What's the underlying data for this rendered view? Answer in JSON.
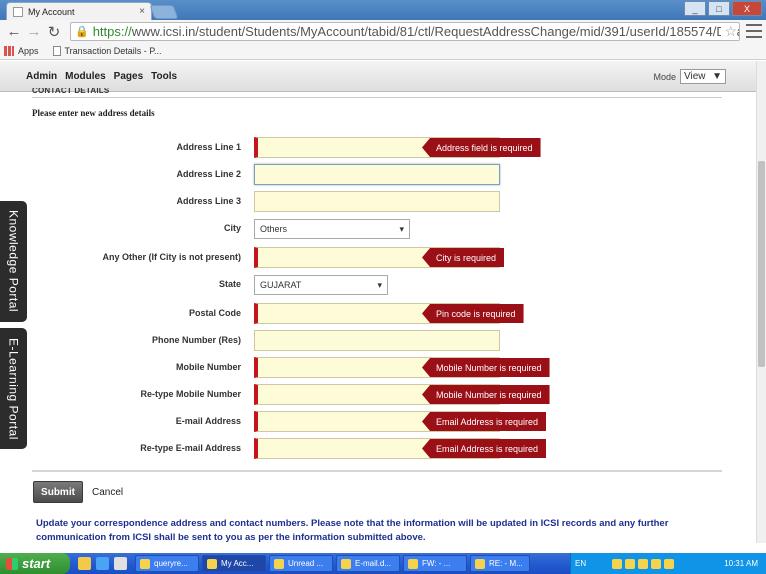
{
  "browser": {
    "tab_title": "My Account",
    "tab_close": "×",
    "url_https": "https://",
    "url_rest": "www.icsi.in/student/Students/MyAccount/tabid/81/ctl/RequestAddressChange/mid/391/userId/185574/Default.a",
    "bookmarks": [
      "Apps",
      "Transaction Details - P..."
    ],
    "window_buttons": [
      "_",
      "□",
      "X"
    ]
  },
  "admin_bar": {
    "links": [
      "Admin",
      "Modules",
      "Pages",
      "Tools"
    ],
    "mode_label": "Mode",
    "mode_value": "View"
  },
  "form": {
    "section_heading": "CONTACT DETAILS",
    "instruction": "Please enter new address details",
    "fields": {
      "address1": {
        "label": "Address Line 1",
        "error": "Address field is required"
      },
      "address2": {
        "label": "Address Line 2"
      },
      "address3": {
        "label": "Address Line 3"
      },
      "city": {
        "label": "City",
        "value": "Others"
      },
      "other_city": {
        "label": "Any Other (If City is not present)",
        "error": "City is required"
      },
      "state": {
        "label": "State",
        "value": "GUJARAT"
      },
      "postal": {
        "label": "Postal Code",
        "error": "Pin code is required"
      },
      "phone": {
        "label": "Phone Number (Res)"
      },
      "mobile": {
        "label": "Mobile Number",
        "error": "Mobile Number is required"
      },
      "mobile2": {
        "label": "Re-type Mobile Number",
        "error": "Mobile Number is required"
      },
      "email": {
        "label": "E-mail Address",
        "error": "Email Address is required"
      },
      "email2": {
        "label": "Re-type E-mail Address",
        "error": "Email Address is required"
      }
    },
    "submit_label": "Submit",
    "cancel_label": "Cancel",
    "notice": "Update your correspondence address and contact numbers. Please note that the information will be updated in ICSI records and any further communication from ICSI shall be sent to you as per the information submitted above."
  },
  "side_tabs": {
    "knowledge": "Knowledge Portal",
    "elearning": "E-Learning Portal"
  },
  "taskbar": {
    "start": "start",
    "tasks": [
      "queryre...",
      "My Acc...",
      "Unread ...",
      "E-mail.d...",
      "FW: - ...",
      "RE: - M..."
    ],
    "lang": "EN",
    "clock": "10:31 AM"
  }
}
